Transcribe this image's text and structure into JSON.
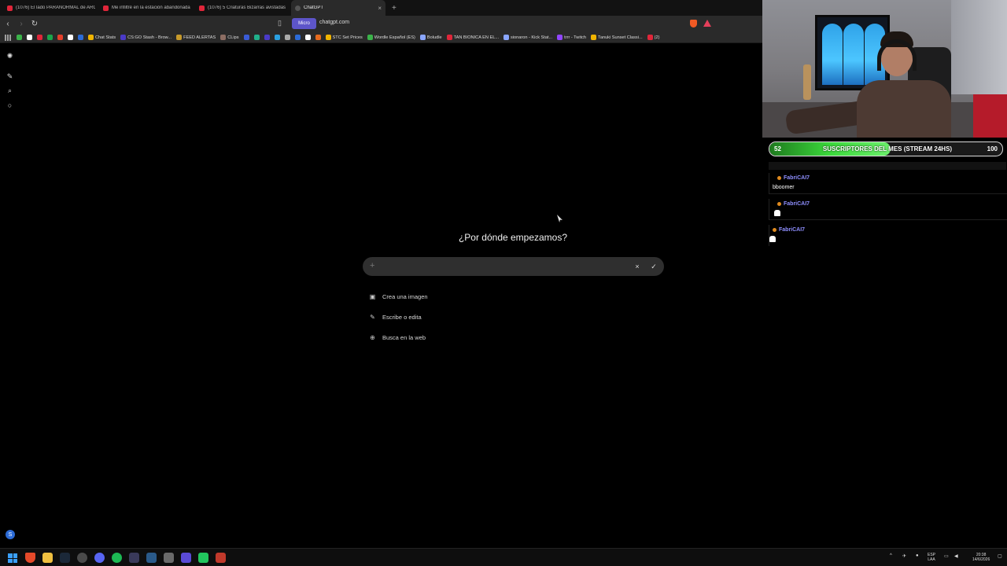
{
  "browser": {
    "tabs": [
      {
        "title": "(1076) El lado PARANORMAL de ARG",
        "active": false
      },
      {
        "title": "Me infiltré en la estación abandonada",
        "active": false
      },
      {
        "title": "(1076) 5 Criaturas Bizarras avistadas",
        "active": false
      },
      {
        "title": "ChatGPT",
        "active": true
      }
    ],
    "new_tab": "+",
    "tab_close": "×",
    "mic_chip": "Micro",
    "url": "chatgpt.com",
    "bookmarks": [
      {
        "label": "",
        "color": "#3bb34a"
      },
      {
        "label": "",
        "color": "#ffffff"
      },
      {
        "label": "",
        "color": "#e0263a"
      },
      {
        "label": "",
        "color": "#1aa64b"
      },
      {
        "label": "",
        "color": "#e53f2a"
      },
      {
        "label": "",
        "color": "#ffffff"
      },
      {
        "label": "",
        "color": "#2c6bd6"
      },
      {
        "label": "Chat Stats",
        "color": "#f0b400"
      },
      {
        "label": "CS:GO Stash - Brow...",
        "color": "#4a3ac7"
      },
      {
        "label": "FEED ALERTAS",
        "color": "#c79a2a"
      },
      {
        "label": "CLips",
        "color": "#8d6e63"
      },
      {
        "label": "",
        "color": "#3a5bd6"
      },
      {
        "label": "",
        "color": "#20b08a"
      },
      {
        "label": "",
        "color": "#4a3ac7"
      },
      {
        "label": "",
        "color": "#2aa0e0"
      },
      {
        "label": "",
        "color": "#aaaaaa"
      },
      {
        "label": "",
        "color": "#2c6bd6"
      },
      {
        "label": "",
        "color": "#ffffff"
      },
      {
        "label": "",
        "color": "#e56a1e"
      },
      {
        "label": "STC Set Prices",
        "color": "#f0b400"
      },
      {
        "label": "Wordle Español (ES)",
        "color": "#3bb34a"
      },
      {
        "label": "Boludle",
        "color": "#8aa6ff"
      },
      {
        "label": "TAN BIONICA EN EL...",
        "color": "#e0263a"
      },
      {
        "label": "sionaron - Kick Stat...",
        "color": "#8aa6ff"
      },
      {
        "label": "trrr - Twitch",
        "color": "#9146ff"
      },
      {
        "label": "Tanuki Sunset Classi...",
        "color": "#f0b400"
      },
      {
        "label": "(2)",
        "color": "#e0263a"
      }
    ]
  },
  "chatgpt": {
    "heading": "¿Por dónde empezamos?",
    "input_value": "",
    "plus": "+",
    "cancel": "×",
    "confirm": "✓",
    "avatar": "S",
    "suggestions": [
      {
        "label": "Crea una imagen",
        "icon": "image-icon"
      },
      {
        "label": "Escribe o edita",
        "icon": "pencil-icon"
      },
      {
        "label": "Busca en la web",
        "icon": "globe-icon"
      }
    ]
  },
  "stream": {
    "sub_goal": {
      "current": "52",
      "target": "100",
      "label": "SUSCRIPTORES DEL MES (STREAM 24HS)",
      "progress": 0.52
    },
    "chat": [
      {
        "user": "FabriCAI7",
        "text": "bboomer",
        "emote": false
      },
      {
        "user": "FabriCAI7",
        "text": "",
        "emote": true
      },
      {
        "user": "FabriCAI7",
        "text": "",
        "emote": true
      }
    ]
  },
  "taskbar": {
    "lang_top": "ESP",
    "lang_bottom": "LAA",
    "time": "20:38",
    "date": "14/6/2026"
  }
}
